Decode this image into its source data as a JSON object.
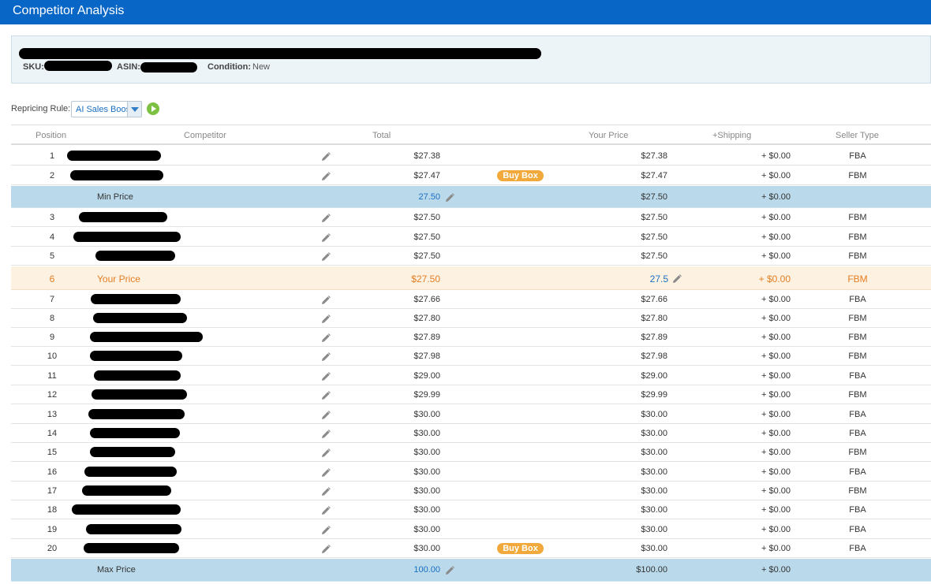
{
  "window": {
    "title": "Competitor Analysis"
  },
  "product": {
    "sku_label": "SKU:",
    "asin_label": "ASIN:",
    "condition_label": "Condition:",
    "condition_value": "New"
  },
  "repricing": {
    "label": "Repricing Rule:",
    "selected": "AI Sales Boost",
    "play_icon": "play-icon"
  },
  "columns": {
    "position": "Position",
    "competitor": "Competitor",
    "total": "Total",
    "your_price": "Your Price",
    "shipping": "+Shipping",
    "seller_type": "Seller Type"
  },
  "colors": {
    "header": "#0866c6",
    "band": "#badaeb",
    "your_row": "#fdf1e2",
    "your_text": "#e67e22",
    "badge": "#f2a93b",
    "link": "#1a6fc2"
  },
  "rows": [
    {
      "kind": "comp",
      "position": "1",
      "total": "$27.38",
      "price": "$27.38",
      "shipping": "+ $0.00",
      "seller": "FBA",
      "buybox": ""
    },
    {
      "kind": "comp",
      "position": "2",
      "total": "$27.47",
      "price": "$27.47",
      "shipping": "+ $0.00",
      "seller": "FBM",
      "buybox": "Buy Box"
    },
    {
      "kind": "min",
      "label": "Min Price",
      "value": "27.50",
      "price": "$27.50",
      "shipping": "+ $0.00"
    },
    {
      "kind": "comp",
      "position": "3",
      "total": "$27.50",
      "price": "$27.50",
      "shipping": "+ $0.00",
      "seller": "FBM",
      "buybox": ""
    },
    {
      "kind": "comp",
      "position": "4",
      "total": "$27.50",
      "price": "$27.50",
      "shipping": "+ $0.00",
      "seller": "FBM",
      "buybox": ""
    },
    {
      "kind": "comp",
      "position": "5",
      "total": "$27.50",
      "price": "$27.50",
      "shipping": "+ $0.00",
      "seller": "FBM",
      "buybox": ""
    },
    {
      "kind": "yours",
      "position": "6",
      "label": "Your Price",
      "total": "$27.50",
      "price": "27.5",
      "shipping": "+ $0.00",
      "seller": "FBM"
    },
    {
      "kind": "comp",
      "position": "7",
      "total": "$27.66",
      "price": "$27.66",
      "shipping": "+ $0.00",
      "seller": "FBA",
      "buybox": ""
    },
    {
      "kind": "comp",
      "position": "8",
      "total": "$27.80",
      "price": "$27.80",
      "shipping": "+ $0.00",
      "seller": "FBM",
      "buybox": ""
    },
    {
      "kind": "comp",
      "position": "9",
      "total": "$27.89",
      "price": "$27.89",
      "shipping": "+ $0.00",
      "seller": "FBM",
      "buybox": ""
    },
    {
      "kind": "comp",
      "position": "10",
      "total": "$27.98",
      "price": "$27.98",
      "shipping": "+ $0.00",
      "seller": "FBM",
      "buybox": ""
    },
    {
      "kind": "comp",
      "position": "11",
      "total": "$29.00",
      "price": "$29.00",
      "shipping": "+ $0.00",
      "seller": "FBA",
      "buybox": ""
    },
    {
      "kind": "comp",
      "position": "12",
      "total": "$29.99",
      "price": "$29.99",
      "shipping": "+ $0.00",
      "seller": "FBM",
      "buybox": ""
    },
    {
      "kind": "comp",
      "position": "13",
      "total": "$30.00",
      "price": "$30.00",
      "shipping": "+ $0.00",
      "seller": "FBA",
      "buybox": ""
    },
    {
      "kind": "comp",
      "position": "14",
      "total": "$30.00",
      "price": "$30.00",
      "shipping": "+ $0.00",
      "seller": "FBA",
      "buybox": ""
    },
    {
      "kind": "comp",
      "position": "15",
      "total": "$30.00",
      "price": "$30.00",
      "shipping": "+ $0.00",
      "seller": "FBM",
      "buybox": ""
    },
    {
      "kind": "comp",
      "position": "16",
      "total": "$30.00",
      "price": "$30.00",
      "shipping": "+ $0.00",
      "seller": "FBA",
      "buybox": ""
    },
    {
      "kind": "comp",
      "position": "17",
      "total": "$30.00",
      "price": "$30.00",
      "shipping": "+ $0.00",
      "seller": "FBM",
      "buybox": ""
    },
    {
      "kind": "comp",
      "position": "18",
      "total": "$30.00",
      "price": "$30.00",
      "shipping": "+ $0.00",
      "seller": "FBA",
      "buybox": ""
    },
    {
      "kind": "comp",
      "position": "19",
      "total": "$30.00",
      "price": "$30.00",
      "shipping": "+ $0.00",
      "seller": "FBA",
      "buybox": ""
    },
    {
      "kind": "comp",
      "position": "20",
      "total": "$30.00",
      "price": "$30.00",
      "shipping": "+ $0.00",
      "seller": "FBA",
      "buybox": "Buy Box"
    },
    {
      "kind": "max",
      "label": "Max Price",
      "value": "100.00",
      "price": "$100.00",
      "shipping": "+ $0.00"
    }
  ]
}
